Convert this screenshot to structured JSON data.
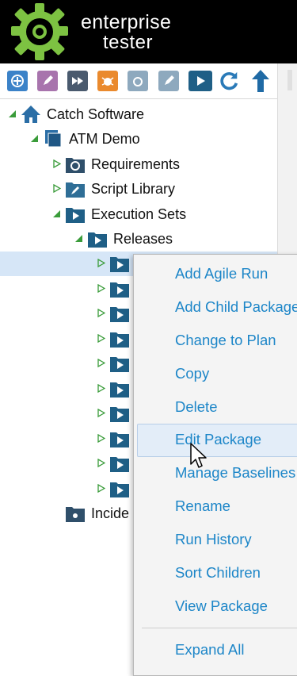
{
  "brand": {
    "line1": "enterprise",
    "line2": "tester",
    "accent": "#7dc242"
  },
  "toolbar": {
    "buttons": [
      {
        "name": "add-run-icon",
        "color": "#3b7fc4"
      },
      {
        "name": "edit-script-icon",
        "color": "#a06aa6"
      },
      {
        "name": "fast-forward-icon",
        "color": "#44546a"
      },
      {
        "name": "incident-icon",
        "color": "#e8832a"
      },
      {
        "name": "new-requirement-icon",
        "color": "#8aa7bd"
      },
      {
        "name": "new-script-icon",
        "color": "#8aa7bd"
      },
      {
        "name": "new-execution-set-icon",
        "color": "#1f5f86"
      },
      {
        "name": "refresh-icon",
        "color": "#2a7ab8"
      },
      {
        "name": "move-up-icon",
        "color": "#1f6aa5"
      }
    ]
  },
  "tree": {
    "root": "Catch Software",
    "project": "ATM Demo",
    "requirements": "Requirements",
    "script_library": "Script Library",
    "execution_sets": "Execution Sets",
    "releases": "Releases",
    "incidents": "Incide"
  },
  "menu": {
    "items": [
      "Add Agile Run",
      "Add Child Package",
      "Change to Plan",
      "Copy",
      "Delete",
      "Edit Package",
      "Manage Baselines",
      "Rename",
      "Run History",
      "Sort Children",
      "View Package"
    ],
    "expand_all": "Expand All"
  }
}
